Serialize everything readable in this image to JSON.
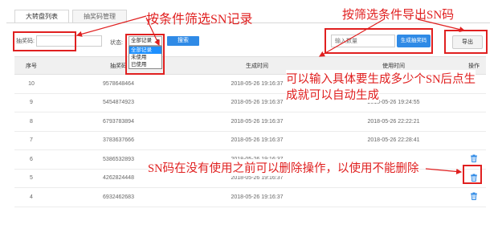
{
  "tabs": [
    {
      "label": "大转盘列表",
      "active": true
    },
    {
      "label": "抽奖码管理",
      "active": false
    }
  ],
  "filter": {
    "code_label": "抽奖码:",
    "code_value": "",
    "status_label": "状态:",
    "status_selected": "全部记录",
    "status_options": [
      "全部记录",
      "未使用",
      "已使用"
    ],
    "search_label": "搜索"
  },
  "generate": {
    "qty_placeholder": "输入数量",
    "button_label": "生成抽奖码"
  },
  "export_label": "导出",
  "table": {
    "headers": [
      "序号",
      "抽奖码",
      "生成时间",
      "使用时间",
      "操作"
    ],
    "rows": [
      {
        "id": "10",
        "code": "9578648464",
        "created": "2018-05-26 19:16:37",
        "used": "2018-05-26 19:17:31",
        "deletable": false
      },
      {
        "id": "9",
        "code": "5454874923",
        "created": "2018-05-26 19:16:37",
        "used": "2018-05-26 19:24:55",
        "deletable": false
      },
      {
        "id": "8",
        "code": "6793783894",
        "created": "2018-05-26 19:16:37",
        "used": "2018-05-26 22:22:21",
        "deletable": false
      },
      {
        "id": "7",
        "code": "3783637666",
        "created": "2018-05-26 19:16:37",
        "used": "2018-05-26 22:28:41",
        "deletable": false
      },
      {
        "id": "6",
        "code": "5386532893",
        "created": "2018-05-26 19:16:37",
        "used": "",
        "deletable": true
      },
      {
        "id": "5",
        "code": "4262824448",
        "created": "2018-05-26 19:16:37",
        "used": "",
        "deletable": true
      },
      {
        "id": "4",
        "code": "6932462683",
        "created": "2018-05-26 19:16:37",
        "used": "",
        "deletable": true
      }
    ]
  },
  "annotations": {
    "filter_note": "按条件筛选SN记录",
    "export_note": "按筛选条件导出SN码",
    "generate_note_line1": "可以输入具体要生成多少个SN后点生",
    "generate_note_line2": "成就可以自动生成",
    "delete_note": "SN码在没有使用之前可以删除操作，以使用不能删除"
  },
  "colors": {
    "accent": "#2f8ae6",
    "annotation": "#e02020",
    "header_bg": "#f0f0f0"
  }
}
